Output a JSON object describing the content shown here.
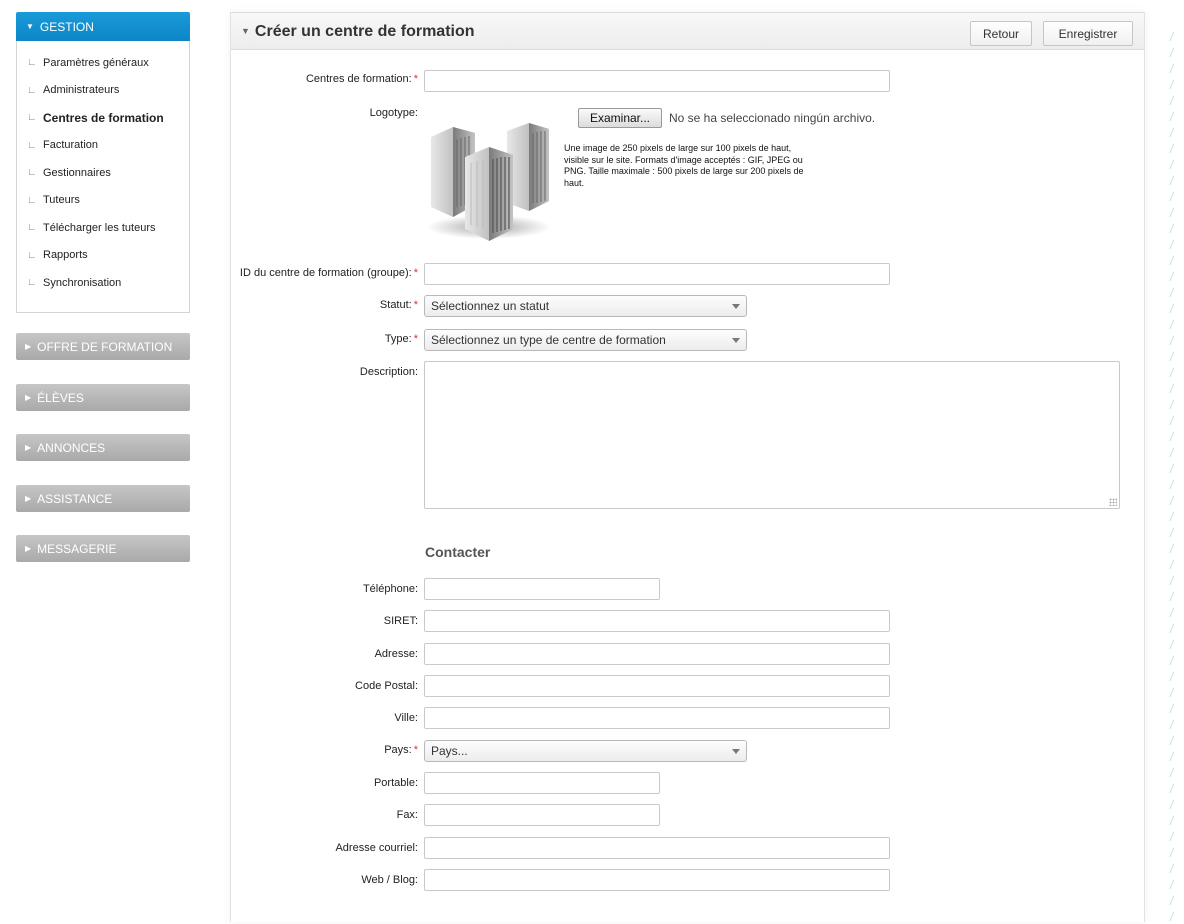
{
  "sidebar": {
    "active_section": "GESTION",
    "items": [
      {
        "label": "Paramètres généraux",
        "active": false
      },
      {
        "label": "Administrateurs",
        "active": false
      },
      {
        "label": "Centres de formation",
        "active": true
      },
      {
        "label": "Facturation",
        "active": false
      },
      {
        "label": "Gestionnaires",
        "active": false
      },
      {
        "label": "Tuteurs",
        "active": false
      },
      {
        "label": "Télécharger les tuteurs",
        "active": false
      },
      {
        "label": "Rapports",
        "active": false
      },
      {
        "label": "Synchronisation",
        "active": false
      }
    ],
    "collapsed_sections": [
      "OFFRE DE FORMATION",
      "ÉLÈVES",
      "ANNONCES",
      "ASSISTANCE",
      "MESSAGERIE"
    ]
  },
  "header": {
    "title": "Créer un centre de formation",
    "back_label": "Retour",
    "save_label": "Enregistrer"
  },
  "form": {
    "required_marker": "*",
    "centres": {
      "label": "Centres de formation:",
      "value": ""
    },
    "logotype": {
      "label": "Logotype:",
      "browse_label": "Examinar...",
      "file_status": "No se ha seleccionado ningún archivo.",
      "help": "Une image de 250 pixels de large sur 100 pixels de haut, visible sur le site. Formats d'image acceptés : GIF, JPEG ou PNG. Taille maximale : 500 pixels de large sur 200 pixels de haut."
    },
    "id_groupe": {
      "label": "ID du centre de formation (groupe):",
      "value": ""
    },
    "statut": {
      "label": "Statut:",
      "selected": "Sélectionnez un statut"
    },
    "type": {
      "label": "Type:",
      "selected": "Sélectionnez un type de centre de formation"
    },
    "description": {
      "label": "Description:",
      "value": ""
    },
    "contact_title": "Contacter",
    "telephone": {
      "label": "Téléphone:",
      "value": ""
    },
    "siret": {
      "label": "SIRET:",
      "value": ""
    },
    "adresse": {
      "label": "Adresse:",
      "value": ""
    },
    "code_postal": {
      "label": "Code Postal:",
      "value": ""
    },
    "ville": {
      "label": "Ville:",
      "value": ""
    },
    "pays": {
      "label": "Pays:",
      "selected": "Pays..."
    },
    "portable": {
      "label": "Portable:",
      "value": ""
    },
    "fax": {
      "label": "Fax:",
      "value": ""
    },
    "courriel": {
      "label": "Adresse courriel:",
      "value": ""
    },
    "web": {
      "label": "Web / Blog:",
      "value": ""
    }
  },
  "colors": {
    "accent": "#0d86c7",
    "required": "#e03030",
    "collapsed_menu": "#b5b5b5"
  },
  "icons": {
    "logo_placeholder": "buildings-icon",
    "expanded": "triangle-down-icon",
    "collapsed": "triangle-right-icon"
  }
}
